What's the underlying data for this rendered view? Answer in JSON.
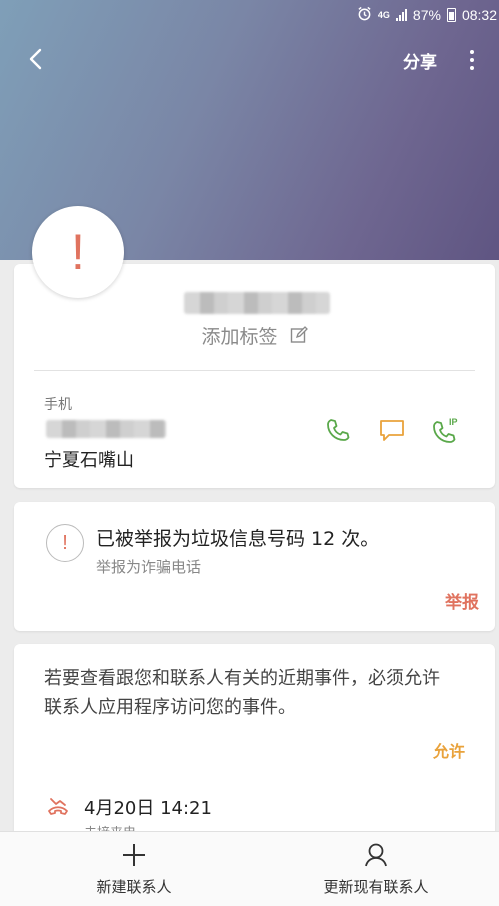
{
  "status_bar": {
    "network": "4G",
    "battery": "87%",
    "time": "08:32"
  },
  "topbar": {
    "share_label": "分享"
  },
  "profile": {
    "avatar_symbol": "!",
    "add_tag_label": "添加标签",
    "phone_type_label": "手机",
    "location": "宁夏石嘴山",
    "ip_badge": "IP"
  },
  "spam_card": {
    "symbol": "!",
    "title": "已被举报为垃圾信息号码 12 次。",
    "subtitle": "举报为诈骗电话",
    "report_label": "举报"
  },
  "events_card": {
    "message": "若要查看跟您和联系人有关的近期事件，必须允许联系人应用程序访问您的事件。",
    "allow_label": "允许",
    "last_call_date": "4月20日 14:21",
    "last_call_type": "未接来电"
  },
  "bottom_bar": {
    "new_contact_label": "新建联系人",
    "update_contact_label": "更新现有联系人"
  },
  "colors": {
    "accent_red": "#e0735f",
    "accent_orange": "#e9a23b",
    "call_green": "#5aa84a"
  }
}
